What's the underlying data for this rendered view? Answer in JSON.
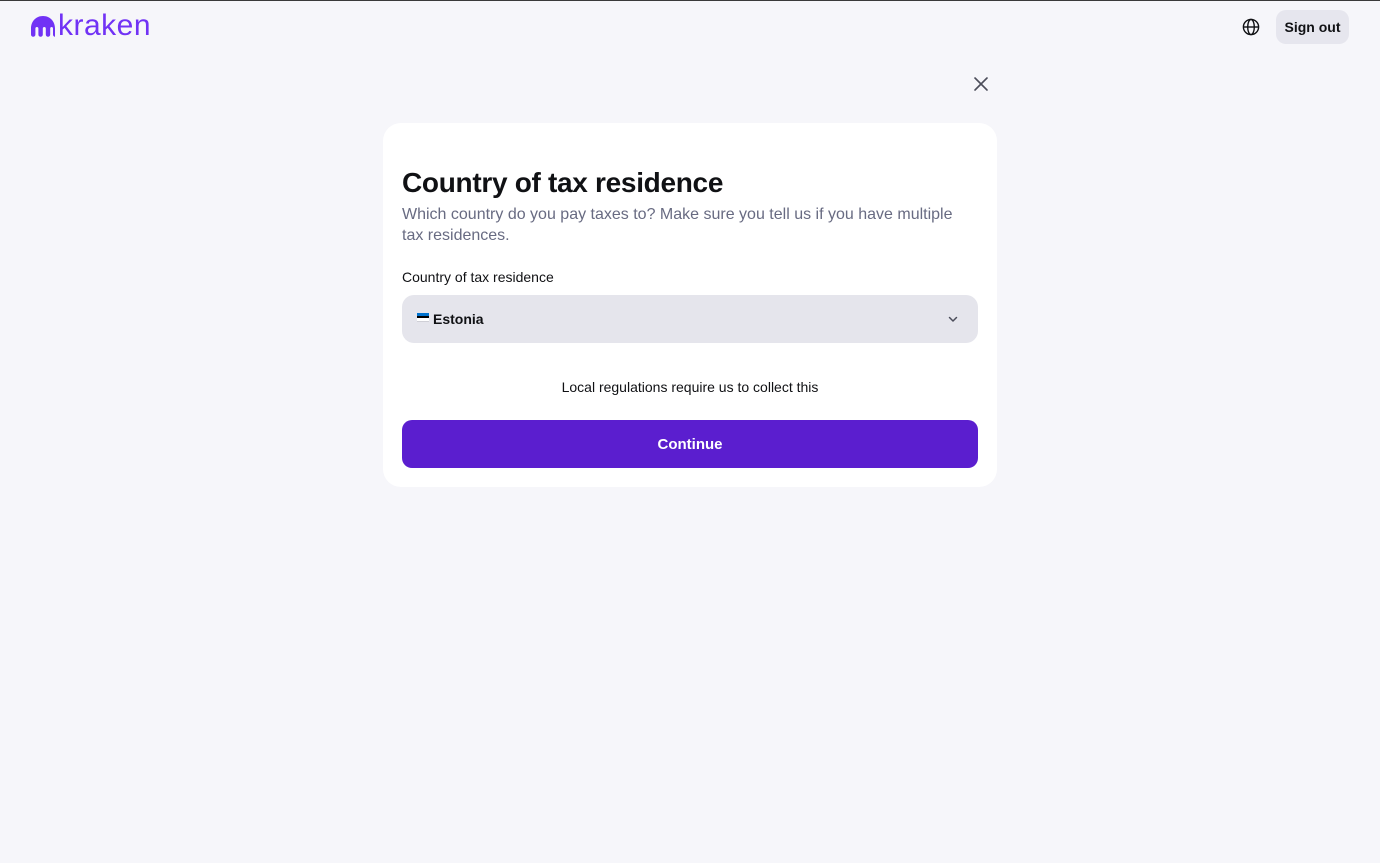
{
  "header": {
    "brand": "kraken",
    "logo_icon": "kraken-logo-icon",
    "language_icon": "globe-icon",
    "sign_out_label": "Sign out"
  },
  "dialog": {
    "close_icon": "close-icon",
    "title": "Country of tax residence",
    "subtitle": "Which country do you pay taxes to? Make sure you tell us if you have multiple tax residences.",
    "field_label": "Country of tax residence",
    "selected_country": "Estonia",
    "flag_icon": "estonia-flag-icon",
    "dropdown_icon": "chevron-down-icon",
    "notice": "Local regulations require us to collect this",
    "continue_label": "Continue"
  },
  "colors": {
    "brand": "#7132f5",
    "primary_button": "#5b1ecf",
    "background": "#f6f6fa",
    "select_bg": "#e5e5ec",
    "muted_text": "#686b82"
  }
}
